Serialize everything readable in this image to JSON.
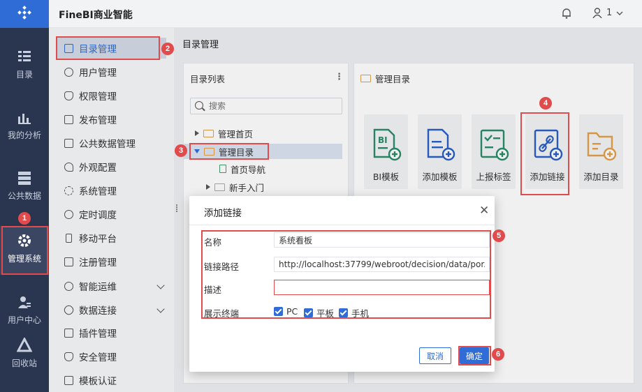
{
  "colors": {
    "accent": "#2f6cd6",
    "rail": "#2a3550",
    "highlight": "#e24b4b"
  },
  "app": {
    "title": "FineBI商业智能"
  },
  "header": {
    "user_label": "1"
  },
  "rail": [
    {
      "label": "目录",
      "icon": "directory-icon"
    },
    {
      "label": "我的分析",
      "icon": "analysis-icon"
    },
    {
      "label": "公共数据",
      "icon": "public-data-icon"
    },
    {
      "label": "管理系统",
      "icon": "management-gear-icon"
    },
    {
      "label": "用户中心",
      "icon": "user-center-icon"
    },
    {
      "label": "回收站",
      "icon": "recycle-bin-icon"
    }
  ],
  "sidebar": {
    "items": [
      {
        "label": "目录管理"
      },
      {
        "label": "用户管理"
      },
      {
        "label": "权限管理"
      },
      {
        "label": "发布管理"
      },
      {
        "label": "公共数据管理"
      },
      {
        "label": "外观配置"
      },
      {
        "label": "系统管理"
      },
      {
        "label": "定时调度"
      },
      {
        "label": "移动平台"
      },
      {
        "label": "注册管理"
      },
      {
        "label": "智能运维"
      },
      {
        "label": "数据连接"
      },
      {
        "label": "插件管理"
      },
      {
        "label": "安全管理"
      },
      {
        "label": "模板认证"
      }
    ]
  },
  "main": {
    "title": "目录管理"
  },
  "tree": {
    "title": "目录列表",
    "search_placeholder": "搜索",
    "nodes": [
      {
        "label": "管理首页"
      },
      {
        "label": "管理目录"
      },
      {
        "label": "首页导航"
      },
      {
        "label": "新手入门"
      }
    ]
  },
  "content": {
    "title": "管理目录",
    "cards": [
      {
        "label": "BI模板",
        "icon": "bi-template-icon"
      },
      {
        "label": "添加模板",
        "icon": "add-template-icon"
      },
      {
        "label": "上报标签",
        "icon": "report-tag-icon"
      },
      {
        "label": "添加链接",
        "icon": "add-link-icon"
      },
      {
        "label": "添加目录",
        "icon": "add-directory-icon"
      }
    ]
  },
  "modal": {
    "title": "添加链接",
    "name_label": "名称",
    "name_value": "系统看板",
    "path_label": "链接路径",
    "path_value": "http://localhost:37799/webroot/decision/data/por...",
    "desc_label": "描述",
    "desc_value": "",
    "terminal_label": "展示终端",
    "terminals": [
      "PC",
      "平板",
      "手机"
    ],
    "cancel_label": "取消",
    "ok_label": "确定"
  },
  "annotations": [
    "1",
    "2",
    "3",
    "4",
    "5",
    "6"
  ]
}
